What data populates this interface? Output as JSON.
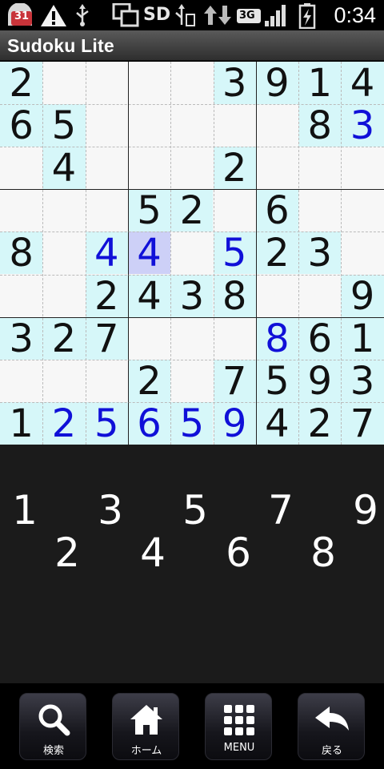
{
  "status_bar": {
    "calendar_badge": "31",
    "sd_label": "SD",
    "network_label": "3G",
    "time": "0:34"
  },
  "app": {
    "title": "Sudoku Lite"
  },
  "board": {
    "rows": [
      [
        "2",
        "",
        "",
        "",
        "",
        "3",
        "9",
        "1",
        "4"
      ],
      [
        "6",
        "5",
        "",
        "",
        "",
        "",
        "",
        "8",
        "3"
      ],
      [
        "",
        "4",
        "",
        "",
        "",
        "2",
        "",
        "",
        ""
      ],
      [
        "",
        "",
        "",
        "5",
        "2",
        "",
        "6",
        "",
        ""
      ],
      [
        "8",
        "",
        "4",
        "4",
        "",
        "5",
        "2",
        "3",
        ""
      ],
      [
        "",
        "",
        "2",
        "4",
        "3",
        "8",
        "",
        "",
        "9"
      ],
      [
        "3",
        "2",
        "7",
        "",
        "",
        "",
        "8",
        "6",
        "1"
      ],
      [
        "",
        "",
        "",
        "2",
        "",
        "7",
        "5",
        "9",
        "3"
      ],
      [
        "1",
        "2",
        "5",
        "6",
        "5",
        "9",
        "4",
        "2",
        "7"
      ]
    ],
    "shade": [
      [
        "g",
        "",
        "",
        "",
        "",
        "g",
        "g",
        "g",
        "g"
      ],
      [
        "g",
        "g",
        "",
        "",
        "",
        "",
        "",
        "g",
        "g"
      ],
      [
        "",
        "g",
        "",
        "",
        "",
        "g",
        "",
        "",
        ""
      ],
      [
        "",
        "",
        "",
        "g",
        "g",
        "",
        "g",
        "",
        ""
      ],
      [
        "g",
        "",
        "g",
        "s",
        "",
        "g",
        "g",
        "g",
        ""
      ],
      [
        "",
        "",
        "g",
        "g",
        "g",
        "g",
        "",
        "",
        "g"
      ],
      [
        "g",
        "g",
        "g",
        "",
        "",
        "",
        "g",
        "g",
        "g"
      ],
      [
        "",
        "",
        "",
        "g",
        "",
        "g",
        "g",
        "g",
        "g"
      ],
      [
        "g",
        "g",
        "g",
        "g",
        "g",
        "g",
        "g",
        "g",
        "g"
      ]
    ],
    "entered": [
      [
        0,
        0,
        0,
        0,
        0,
        0,
        0,
        0,
        0
      ],
      [
        0,
        0,
        0,
        0,
        0,
        0,
        0,
        0,
        1
      ],
      [
        0,
        0,
        0,
        0,
        0,
        0,
        0,
        0,
        0
      ],
      [
        0,
        0,
        0,
        0,
        0,
        0,
        0,
        0,
        0
      ],
      [
        0,
        0,
        1,
        1,
        0,
        1,
        0,
        0,
        0
      ],
      [
        0,
        0,
        0,
        0,
        0,
        0,
        0,
        0,
        0
      ],
      [
        0,
        0,
        0,
        0,
        0,
        0,
        1,
        0,
        0
      ],
      [
        0,
        0,
        0,
        0,
        0,
        0,
        0,
        0,
        0
      ],
      [
        0,
        1,
        1,
        1,
        1,
        1,
        0,
        0,
        0
      ]
    ],
    "colors": {
      "given_bg": "#d6f7f9",
      "selected_bg": "#cdd0f7",
      "entered_text": "#1010d8",
      "normal_text": "#111111"
    }
  },
  "number_pad": {
    "keys": [
      "1",
      "2",
      "3",
      "4",
      "5",
      "6",
      "7",
      "8",
      "9"
    ]
  },
  "soft_keys": [
    {
      "label": "検索",
      "icon": "search-icon"
    },
    {
      "label": "ホーム",
      "icon": "home-icon"
    },
    {
      "label": "MENU",
      "icon": "menu-grid-icon"
    },
    {
      "label": "戻る",
      "icon": "back-arrow-icon"
    }
  ]
}
